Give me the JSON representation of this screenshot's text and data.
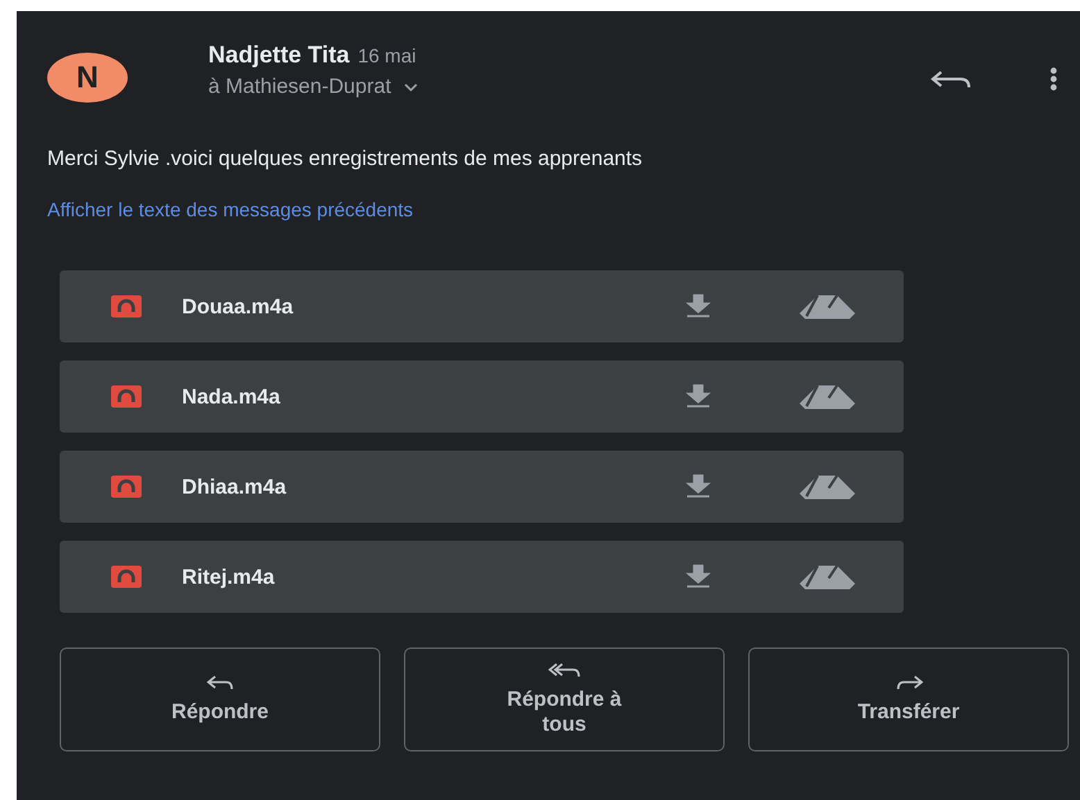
{
  "message": {
    "avatar_letter": "N",
    "sender": "Nadjette Tita",
    "date": "16 mai",
    "recipient": "à Mathiesen-Duprat",
    "body": "Merci Sylvie .voici quelques enregistrements de mes apprenants",
    "show_quoted": "Afficher le texte des messages précédents"
  },
  "attachments": [
    {
      "name": "Douaa.m4a"
    },
    {
      "name": "Nada.m4a"
    },
    {
      "name": "Dhiaa.m4a"
    },
    {
      "name": "Ritej.m4a"
    }
  ],
  "actions": [
    {
      "kind": "reply",
      "label": "Répondre"
    },
    {
      "kind": "reply_all",
      "label": "Répondre à tous"
    },
    {
      "kind": "forward",
      "label": "Transférer"
    }
  ]
}
